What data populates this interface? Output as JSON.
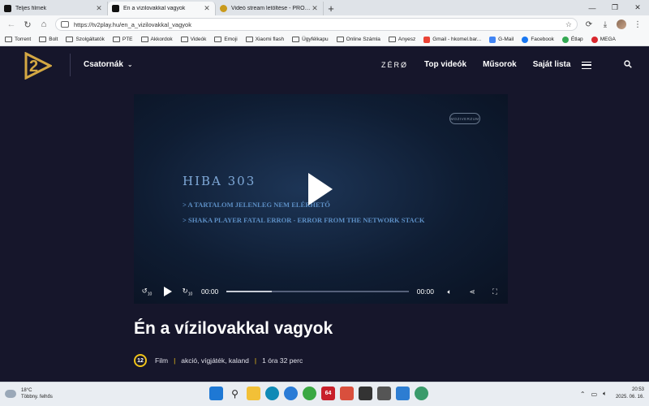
{
  "browser": {
    "tabs": [
      {
        "title": "Teljes filmek",
        "active": false,
        "favicon_color": "#111111"
      },
      {
        "title": "Én a vízilovakkal vagyok",
        "active": true,
        "favicon_color": "#111111"
      },
      {
        "title": "Videó stream letöltése - PROHARDVER!",
        "active": false,
        "favicon_color": "#c99a1c"
      }
    ],
    "url": "https://tv2play.hu/en_a_vizilovakkal_vagyok",
    "bookmarks": [
      {
        "label": "Torrent",
        "type": "folder"
      },
      {
        "label": "Bolt",
        "type": "folder"
      },
      {
        "label": "Szolgáltatók",
        "type": "folder"
      },
      {
        "label": "PTE",
        "type": "folder"
      },
      {
        "label": "Akkordok",
        "type": "folder"
      },
      {
        "label": "Videók",
        "type": "folder"
      },
      {
        "label": "Emoji",
        "type": "folder"
      },
      {
        "label": "Xiaomi flash",
        "type": "folder"
      },
      {
        "label": "Ügyfélkapu",
        "type": "folder"
      },
      {
        "label": "Online Számla",
        "type": "folder"
      },
      {
        "label": "Anyesz",
        "type": "folder"
      },
      {
        "label": "Gmail - hkomel.bar...",
        "type": "site",
        "color": "#ea4335"
      },
      {
        "label": "G-Mail",
        "type": "site",
        "color": "#4285f4"
      },
      {
        "label": "Facebook",
        "type": "site",
        "color": "#1877f2"
      },
      {
        "label": "Étlap",
        "type": "site",
        "color": "#34a853"
      },
      {
        "label": "MEGA",
        "type": "site",
        "color": "#d9272e"
      }
    ]
  },
  "site": {
    "channels_label": "Csatornák",
    "nav": {
      "zero": "ZÉRØ",
      "top_videos": "Top videók",
      "shows": "Műsorok",
      "my_list": "Saját lista"
    },
    "player": {
      "watermark": "MOZIVERZUM",
      "error_title": "HIBA 303",
      "error_line1": "> A TARTALOM JELENLEG NEM ELÉRHETŐ",
      "error_line2": "> SHAKA PLAYER FATAL ERROR - ERROR FROM THE NETWORK STACK",
      "current_time": "00:00",
      "duration": "00:00",
      "progress": 0.25,
      "skip_back": "10",
      "skip_fwd": "10"
    },
    "movie": {
      "title": "Én a vízilovakkal vagyok",
      "age_rating": "12",
      "type": "Film",
      "genres": "akció, vígjáték, kaland",
      "duration": "1 óra 32 perc"
    }
  },
  "taskbar": {
    "temperature": "18°C",
    "weather": "Többny. felhős",
    "time": "20:53",
    "date": "2025. 06. 16.",
    "badge": "64"
  }
}
